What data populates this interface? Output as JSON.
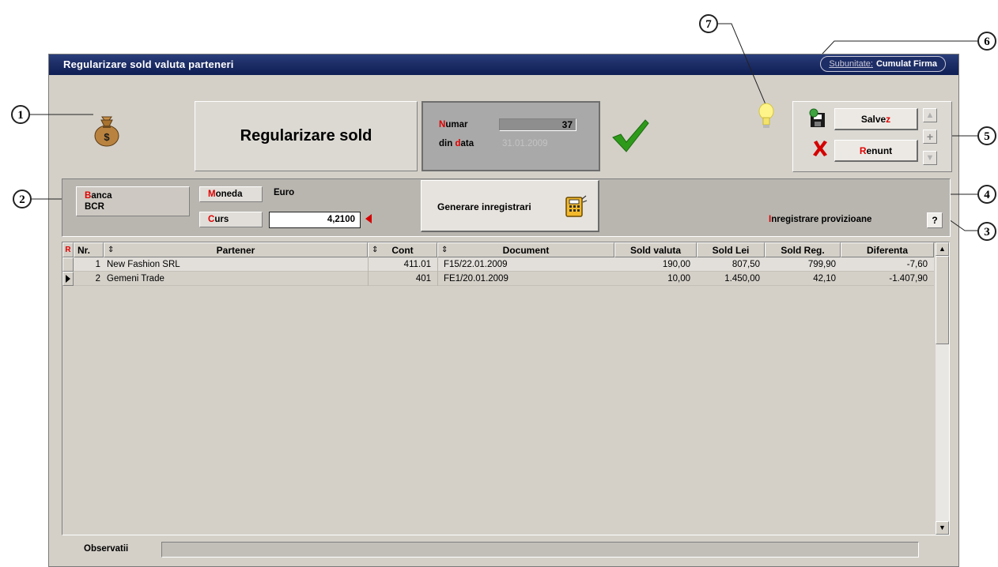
{
  "window": {
    "title": "Regularizare sold valuta parteneri",
    "subunit_label": "Subunitate:",
    "subunit_value": "Cumulat Firma"
  },
  "header": {
    "doc_type": "Regularizare sold",
    "numar_label": "umar",
    "numar_prefix": "N",
    "numar_value": "37",
    "data_label_pre": "din ",
    "data_label_red": "d",
    "data_label_post": "ata",
    "data_value": "31.01.2009"
  },
  "actions": {
    "save_prefix": "Salve",
    "save_hot": "z",
    "cancel_hot": "R",
    "cancel_rest": "enunt"
  },
  "params": {
    "banca_hot": "B",
    "banca_rest": "anca",
    "banca_value": "BCR",
    "moneda_hot": "M",
    "moneda_rest": "oneda",
    "moneda_value": "Euro",
    "curs_hot": "C",
    "curs_rest": "urs",
    "curs_value": "4,2100",
    "generate_label": "Generare inregistrari",
    "provision_hot": "I",
    "provision_rest": "nregistrare provizioane",
    "help_label": "?"
  },
  "table": {
    "columns": [
      "Nr.",
      "Partener",
      "Cont",
      "Document",
      "Sold valuta",
      "Sold Lei",
      "Sold Reg.",
      "Diferenta"
    ],
    "corner": "R",
    "rows": [
      {
        "nr": "1",
        "partener": "New Fashion SRL",
        "cont": "411.01",
        "document": "F15/22.01.2009",
        "sold_valuta": "190,00",
        "sold_lei": "807,50",
        "sold_reg": "799,90",
        "diferenta": "-7,60"
      },
      {
        "nr": "2",
        "partener": "Gemeni Trade",
        "cont": "401",
        "document": "FE1/20.01.2009",
        "sold_valuta": "10,00",
        "sold_lei": "1.450,00",
        "sold_reg": "42,10",
        "diferenta": "-1.407,90"
      }
    ]
  },
  "footer": {
    "observatii_label": "Observatii",
    "observatii_value": ""
  },
  "callouts": [
    "1",
    "2",
    "3",
    "4",
    "5",
    "6",
    "7"
  ],
  "colors": {
    "titlebar": "#1d2d66",
    "panel": "#d4d0c8",
    "hotkey": "#e00000",
    "check": "#2e9a1a"
  }
}
